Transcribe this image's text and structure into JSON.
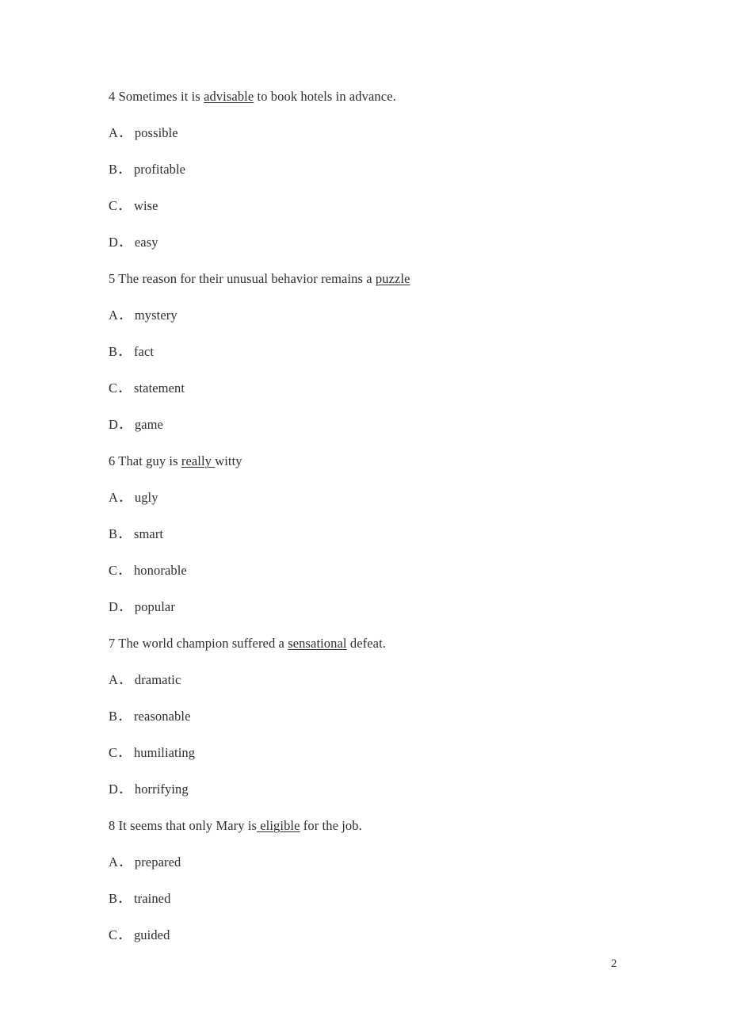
{
  "document": {
    "page_number": "2",
    "background_color": "#ffffff",
    "text_color": "#2e2e2e"
  },
  "questions": [
    {
      "number": "4",
      "stem_before": "4 Sometimes it is ",
      "stem_underlined": "advisable",
      "stem_after": " to book hotels in advance.",
      "options": [
        {
          "letter": "A．",
          "text": " possible"
        },
        {
          "letter": "B．",
          "text": " profitable"
        },
        {
          "letter": "C．",
          "text": " wise"
        },
        {
          "letter": "D．",
          "text": " easy"
        }
      ]
    },
    {
      "number": "5",
      "stem_before": "5 The reason for their unusual behavior remains a ",
      "stem_underlined": "puzzle",
      "stem_after": "",
      "options": [
        {
          "letter": "A．",
          "text": " mystery"
        },
        {
          "letter": "B．",
          "text": " fact"
        },
        {
          "letter": "C．",
          "text": " statement"
        },
        {
          "letter": "D．",
          "text": " game"
        }
      ]
    },
    {
      "number": "6",
      "stem_before": "6 That guy is ",
      "stem_underlined": "really ",
      "stem_after": "witty",
      "options": [
        {
          "letter": "A．",
          "text": " ugly"
        },
        {
          "letter": "B．",
          "text": " smart"
        },
        {
          "letter": "C．",
          "text": " honorable"
        },
        {
          "letter": "D．",
          "text": " popular"
        }
      ]
    },
    {
      "number": "7",
      "stem_before": "7 The world champion suffered a ",
      "stem_underlined": "sensational",
      "stem_after": " defeat.",
      "options": [
        {
          "letter": "A．",
          "text": " dramatic"
        },
        {
          "letter": "B．",
          "text": " reasonable"
        },
        {
          "letter": "C．",
          "text": " humiliating"
        },
        {
          "letter": "D．",
          "text": " horrifying"
        }
      ]
    },
    {
      "number": "8",
      "stem_before": "8 It seems that only Mary is",
      "stem_underlined": " eligible",
      "stem_after": " for the job.",
      "options": [
        {
          "letter": "A．",
          "text": " prepared"
        },
        {
          "letter": "B．",
          "text": " trained"
        },
        {
          "letter": "C．",
          "text": " guided"
        }
      ]
    }
  ]
}
